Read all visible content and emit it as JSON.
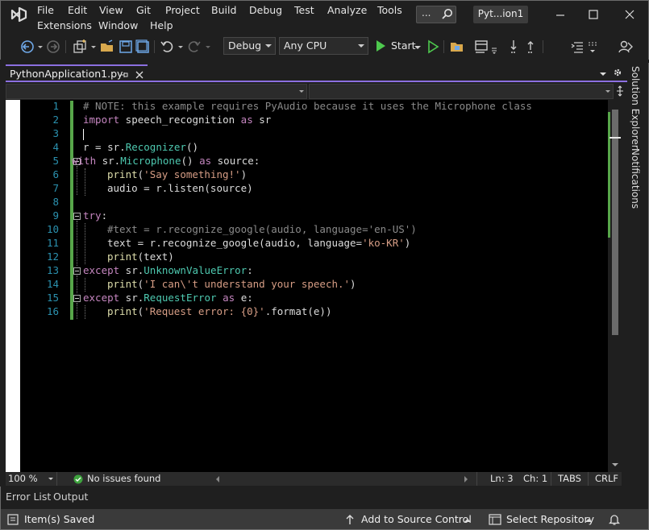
{
  "menu": {
    "row1": [
      "File",
      "Edit",
      "View",
      "Git",
      "Project",
      "Build",
      "Debug",
      "Test",
      "Analyze",
      "Tools"
    ],
    "row2": [
      "Extensions",
      "Window",
      "Help"
    ]
  },
  "search": {
    "dots": "..."
  },
  "solution_name": "Pyt...ion1",
  "toolbar": {
    "config": "Debug",
    "platform": "Any CPU",
    "start_label": "Start"
  },
  "tab": {
    "label": "PythonApplication1.py"
  },
  "code_lines": [
    {
      "n": "1"
    },
    {
      "n": "2"
    },
    {
      "n": "3"
    },
    {
      "n": "4"
    },
    {
      "n": "5"
    },
    {
      "n": "6"
    },
    {
      "n": "7"
    },
    {
      "n": "8"
    },
    {
      "n": "9"
    },
    {
      "n": "10"
    },
    {
      "n": "11"
    },
    {
      "n": "12"
    },
    {
      "n": "13"
    },
    {
      "n": "14"
    },
    {
      "n": "15"
    },
    {
      "n": "16"
    }
  ],
  "code": {
    "l1": "# NOTE: this example requires PyAudio because it uses the Microphone class",
    "l2_kw": "import",
    "l2_rest": " speech_recognition ",
    "l2_as": "as",
    "l2_end": " sr",
    "l4_a": "r = sr.",
    "l4_cls": "Recognizer",
    "l4_b": "()",
    "l5_kw": "with",
    "l5_a": " sr.",
    "l5_cls": "Microphone",
    "l5_b": "() ",
    "l5_as": "as",
    "l5_c": " source:",
    "l6_fn": "print",
    "l6_a": "(",
    "l6_str": "'Say something!'",
    "l6_b": ")",
    "l7": "audio = r.listen(source)",
    "l9_kw": "try",
    "l9_a": ":",
    "l10": "#text = r.recognize_google(audio, language='en-US')",
    "l11_a": "text = r.recognize_google(audio, language=",
    "l11_str": "'ko-KR'",
    "l11_b": ")",
    "l12_fn": "print",
    "l12_a": "(text)",
    "l13_kw": "except",
    "l13_a": " sr.",
    "l13_cls": "UnknownValueError",
    "l13_b": ":",
    "l14_fn": "print",
    "l14_a": "(",
    "l14_str": "'I can\\'t understand your speech.'",
    "l14_b": ")",
    "l15_kw": "except",
    "l15_a": " sr.",
    "l15_cls": "RequestError",
    "l15_b": " ",
    "l15_as": "as",
    "l15_c": " e:",
    "l16_fn": "print",
    "l16_a": "(",
    "l16_str": "'Request error: {0}'",
    "l16_b": ".format(e))"
  },
  "side_panel": {
    "solution_explorer": "Solution Explorer",
    "notifications": "Notifications"
  },
  "editor_status": {
    "zoom": "100 %",
    "issues": "No issues found",
    "line": "Ln: 3",
    "col": "Ch: 1",
    "indent": "TABS",
    "eol": "CRLF"
  },
  "bottom_tabs": [
    "Error List",
    "Output"
  ],
  "statusbar": {
    "saved": "Item(s) Saved",
    "source_control": "Add to Source Control",
    "repository": "Select Repository"
  },
  "colors": {
    "accent": "#8c6fe0",
    "line_number": "#2b91af",
    "keyword": "#c586c0",
    "string": "#d69d85",
    "class": "#4ec9b0",
    "change_bar": "#57a64a"
  }
}
